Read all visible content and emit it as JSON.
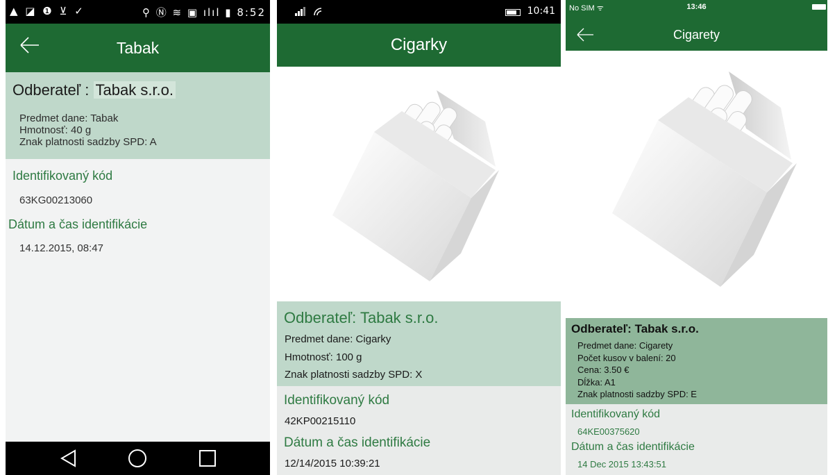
{
  "screens": [
    {
      "status_bar": {
        "left_icons": "▲ ◪ ❶ ⊻ ✓",
        "right_icons": "⚲ Ⓝ ≋ ▣ ılıl ▮",
        "time": "8:52"
      },
      "title": "Tabak",
      "customer_label": "Odberateľ :",
      "customer_value": "Tabak s.r.o.",
      "lines": [
        "Predmet dane: Tabak",
        "Hmotnosť: 40 g",
        "Znak platnosti sadzby SPD: A"
      ],
      "id_label": "Identifikovaný kód",
      "id_value": "63KG00213060",
      "date_label": "Dátum a čas identifikácie",
      "date_value": "14.12.2015, 08:47"
    },
    {
      "status_bar": {
        "time": "10:41"
      },
      "title": "Cigarky",
      "customer": "Odberateľ: Tabak s.r.o.",
      "lines": [
        "Predmet dane: Cigarky",
        "Hmotnosť: 100 g",
        "Znak platnosti sadzby SPD: X"
      ],
      "id_label": "Identifikovaný kód",
      "id_value": "42KP00215110",
      "date_label": "Dátum a čas identifikácie",
      "date_value": "12/14/2015 10:39:21"
    },
    {
      "status_bar": {
        "carrier": "No SIM ᯤ",
        "time": "13:46"
      },
      "title": "Cigarety",
      "customer": "Odberateľ: Tabak s.r.o.",
      "lines": [
        "Predmet dane: Cigarety",
        "Počet kusov v balení: 20",
        "Cena: 3.50 €",
        "Dĺžka: A1",
        "Znak platnosti sadzby SPD: E"
      ],
      "id_label": "Identifikovaný kód",
      "id_value": "64KE00375620",
      "date_label": "Dátum a čas identifikácie",
      "date_value": "14 Dec 2015 13:43:51"
    }
  ],
  "colors": {
    "bar_green": "#1e6a33",
    "label_green": "#2e7a42",
    "info_bg": "#bfd8ca",
    "info_bg_ios": "#8fb69a"
  },
  "icons": [
    "back-arrow-icon",
    "nav-back-icon",
    "nav-home-icon",
    "nav-recents-icon",
    "cigarette-pack-image"
  ]
}
